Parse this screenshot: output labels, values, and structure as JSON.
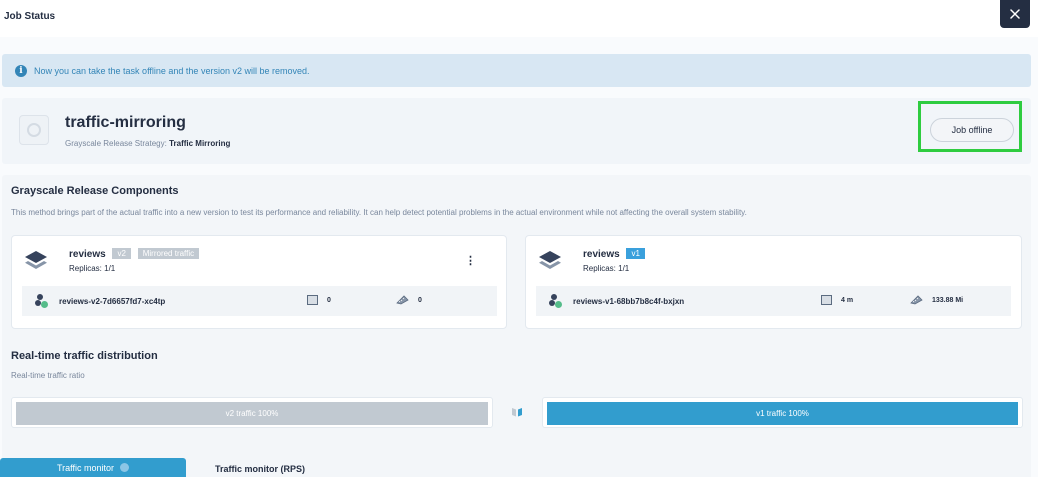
{
  "window": {
    "title": "Job Status"
  },
  "notice": {
    "text": "Now you can take the task offline and the version v2 will be removed."
  },
  "job": {
    "name": "traffic-mirroring",
    "strategy_label": "Grayscale Release Strategy:",
    "strategy_value": "Traffic Mirroring",
    "offline_button": "Job offline"
  },
  "components": {
    "title": "Grayscale Release Components",
    "description": "This method brings part of the actual traffic into a new version to test its performance and reliability. It can help detect potential problems in the actual environment while not affecting the overall system stability.",
    "cards": [
      {
        "name": "reviews",
        "version": "v2",
        "extra_tag": "Mirrored traffic",
        "replicas": "Replicas: 1/1",
        "pod": "reviews-v2-7d6657fd7-xc4tp",
        "cpu": "0",
        "memory": "0"
      },
      {
        "name": "reviews",
        "version": "v1",
        "replicas": "Replicas: 1/1",
        "pod": "reviews-v1-68bb7b8c4f-bxjxn",
        "cpu": "4 m",
        "memory": "133.88 Mi"
      }
    ]
  },
  "realtime": {
    "title": "Real-time traffic distribution",
    "subtitle": "Real-time traffic ratio",
    "v2_label": "v2 traffic 100%",
    "v1_label": "v1 traffic 100%",
    "v2_fill": 1.0,
    "v1_fill": 1.0
  },
  "monitor": {
    "tab_label": "Traffic monitor",
    "panel_title": "Traffic monitor (RPS)"
  },
  "colors": {
    "accent": "#329dce",
    "highlight": "#2ecc40",
    "dark": "#242e42"
  }
}
